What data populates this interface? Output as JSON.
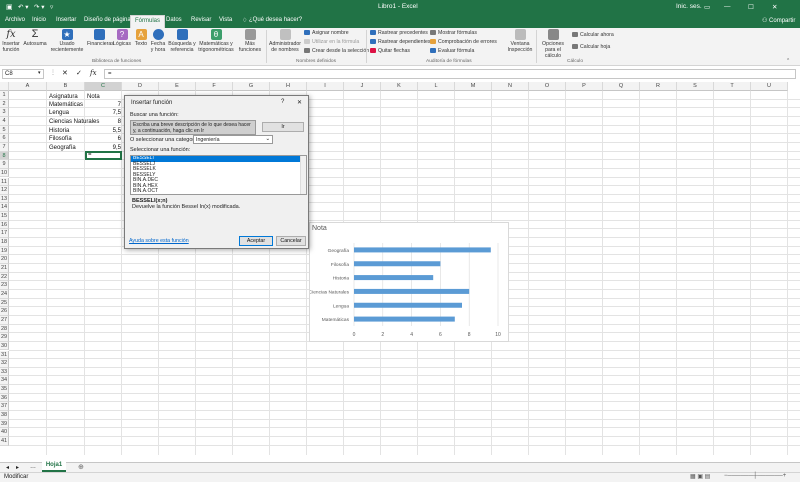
{
  "titlebar": {
    "title": "Libro1 - Excel",
    "user": "Inic. ses.",
    "share": "Compartir"
  },
  "tabs": [
    "Archivo",
    "Inicio",
    "Insertar",
    "Diseño de página",
    "Fórmulas",
    "Datos",
    "Revisar",
    "Vista",
    "¿Qué desea hacer?"
  ],
  "ribbon": {
    "buttons": [
      {
        "n": "insert-function",
        "label": "Insertar función",
        "icon": "fx-icon"
      },
      {
        "n": "autosum",
        "label": "Autosuma",
        "icon": "sigma-icon"
      },
      {
        "n": "recent",
        "label": "Usado recientemente",
        "icon": "star-icon"
      },
      {
        "n": "financial",
        "label": "Financieras",
        "icon": "book-icon"
      },
      {
        "n": "logical",
        "label": "Lógicas",
        "icon": "question-icon"
      },
      {
        "n": "text",
        "label": "Texto",
        "icon": "text-icon"
      },
      {
        "n": "datetime",
        "label": "Fecha y hora",
        "icon": "clock-icon"
      },
      {
        "n": "lookup",
        "label": "Búsqueda y referencia",
        "icon": "lookup-icon"
      },
      {
        "n": "math",
        "label": "Matemáticas y trigonométricas",
        "icon": "theta-icon"
      },
      {
        "n": "more",
        "label": "Más funciones",
        "icon": "more-icon"
      },
      {
        "n": "name-manager",
        "label": "Administrador de nombres",
        "icon": "tag-icon"
      },
      {
        "n": "watch",
        "label": "Ventana Inspección",
        "icon": "watch-window-icon"
      },
      {
        "n": "calc-options",
        "label": "Opciones para el cálculo",
        "icon": "calc-options-icon"
      }
    ],
    "names": [
      "Asignar nombre",
      "Utilizar en la fórmula",
      "Crear desde la selección"
    ],
    "audit": [
      "Rastrear precedentes",
      "Rastrear dependientes",
      "Quitar flechas",
      "Mostrar fórmulas",
      "Comprobación de errores",
      "Evaluar fórmula"
    ],
    "calc": [
      "Calcular ahora",
      "Calcular hoja"
    ],
    "groups": [
      "Biblioteca de funciones",
      "Nombres definidos",
      "Auditoría de fórmulas",
      "Cálculo"
    ]
  },
  "formula_bar": {
    "namebox": "C8",
    "value": "="
  },
  "columns": [
    "A",
    "B",
    "C",
    "D",
    "E",
    "F",
    "G",
    "H",
    "I",
    "J",
    "K",
    "L",
    "M",
    "N",
    "O",
    "P",
    "Q",
    "R",
    "S",
    "T",
    "U"
  ],
  "rows": [
    "1",
    "2",
    "3",
    "4",
    "5",
    "6",
    "7",
    "8",
    "9",
    "10",
    "11",
    "12",
    "13",
    "14",
    "15",
    "16",
    "17",
    "18",
    "19",
    "20",
    "21",
    "22",
    "23",
    "24",
    "25",
    "26",
    "27",
    "28",
    "29",
    "30",
    "31",
    "32",
    "33",
    "34",
    "35",
    "36",
    "37",
    "38",
    "39",
    "40",
    "41"
  ],
  "table": {
    "header": [
      "Asignatura",
      "Nota"
    ],
    "rows": [
      [
        "Matemáticas",
        "7"
      ],
      [
        "Lengua",
        "7,5"
      ],
      [
        "Ciencias Naturales",
        "8"
      ],
      [
        "Historia",
        "5,5"
      ],
      [
        "Filosofía",
        "6"
      ],
      [
        "Geografía",
        "9,5"
      ]
    ],
    "active_cell": "="
  },
  "chart_data": {
    "type": "bar",
    "title": "Nota",
    "categories": [
      "Matemáticas",
      "Lengua",
      "Ciencias Naturales",
      "Historia",
      "Filosofía",
      "Geografía"
    ],
    "values": [
      7,
      7.5,
      8,
      5.5,
      6,
      9.5
    ],
    "xlim": [
      0,
      10
    ],
    "xticks": [
      "0",
      "2",
      "4",
      "6",
      "8",
      "10"
    ],
    "bar_color": "#5b9bd5",
    "grid": true,
    "legend": "none"
  },
  "dialog": {
    "title": "Insertar función",
    "help": "?",
    "close": "✕",
    "search_label": "Buscar una función:",
    "search_text": "Escriba una breve descripción de lo que desea hacer y, a continuación, haga clic en Ir",
    "go": "Ir",
    "category_label": "O seleccionar una categoría:",
    "category": "Ingeniería",
    "select_label": "Seleccionar una función:",
    "functions": [
      "BESSELI",
      "BESSELJ",
      "BESSELK",
      "BESSELY",
      "BIN.A.DEC",
      "BIN.A.HEX",
      "BIN.A.OCT"
    ],
    "signature": "BESSELI(x;n)",
    "description": "Devuelve la función Bessel In(x) modificada.",
    "help_link": "Ayuda sobre esta función",
    "ok": "Aceptar",
    "cancel": "Cancelar"
  },
  "sheet_tab": "Hoja1",
  "status": "Modificar",
  "colors": {
    "excel_green": "#217346",
    "bar": "#5b9bd5",
    "selection": "#0078d7"
  }
}
